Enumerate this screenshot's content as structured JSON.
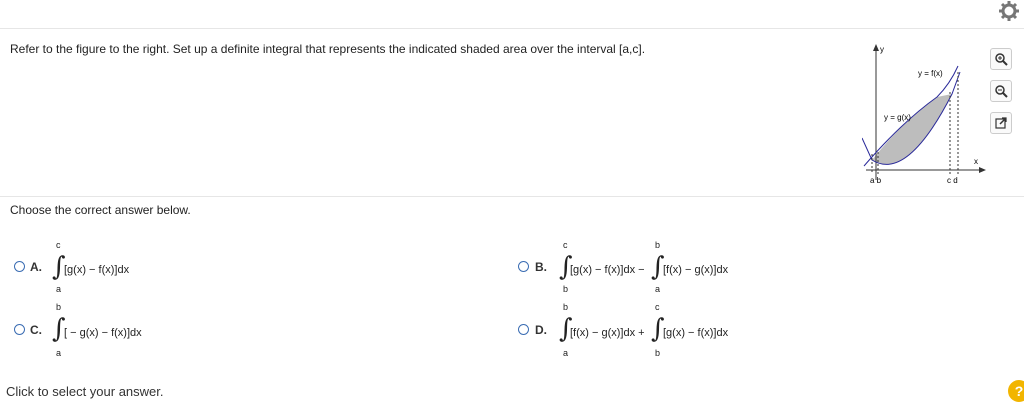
{
  "question": "Refer to the figure to the right. Set up a definite integral that represents the indicated shaded area over the interval [a,c].",
  "figure": {
    "y_axis_label": "y",
    "x_axis_label": "x",
    "f_label": "y = f(x)",
    "g_label": "y = g(x)",
    "tick_labels": "a b",
    "tick_labels_right": "c d"
  },
  "prompt": "Choose the correct answer below.",
  "options": [
    {
      "label": "A.",
      "terms": [
        {
          "upper": "c",
          "lower": "a",
          "expr": "[g(x) − f(x)]dx"
        }
      ]
    },
    {
      "label": "B.",
      "terms": [
        {
          "upper": "c",
          "lower": "b",
          "expr": "[g(x) − f(x)]dx −"
        },
        {
          "upper": "b",
          "lower": "a",
          "expr": "[f(x) − g(x)]dx"
        }
      ]
    },
    {
      "label": "C.",
      "terms": [
        {
          "upper": "b",
          "lower": "a",
          "expr": "[ − g(x) − f(x)]dx"
        }
      ]
    },
    {
      "label": "D.",
      "terms": [
        {
          "upper": "b",
          "lower": "a",
          "expr": "[f(x) − g(x)]dx +"
        },
        {
          "upper": "c",
          "lower": "b",
          "expr": "[g(x) − f(x)]dx"
        }
      ]
    }
  ],
  "footer": "Click to select your answer.",
  "help": "?",
  "colors": {
    "radio": "#3b6db3",
    "help": "#f2b500",
    "curve_f": "#2a2a9a"
  }
}
